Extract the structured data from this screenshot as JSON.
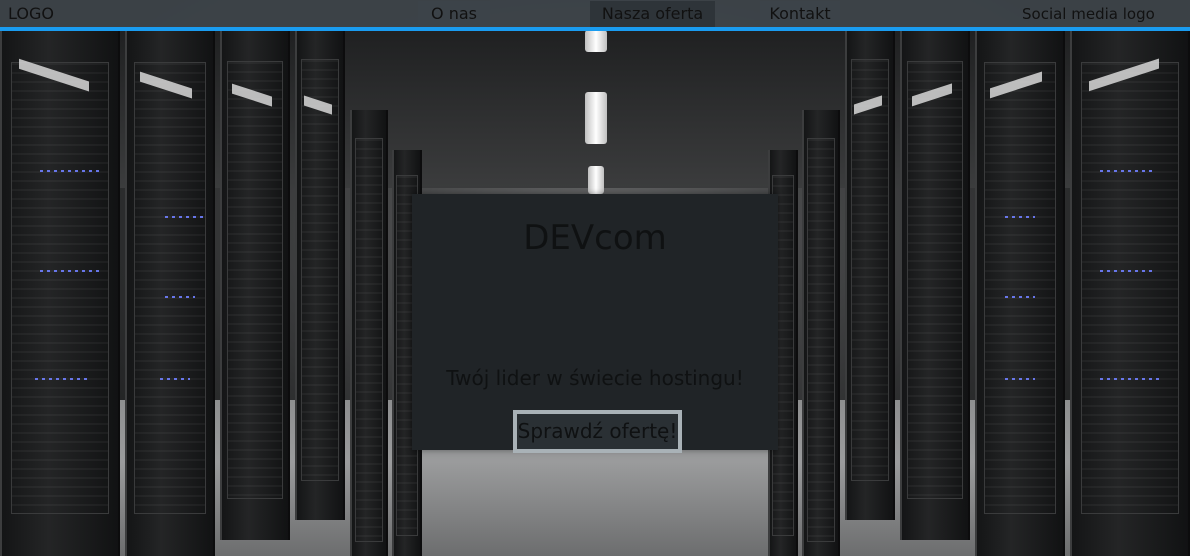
{
  "header": {
    "logo": "LOGO",
    "nav": [
      {
        "label": "O nas"
      },
      {
        "label": "Nasza oferta"
      },
      {
        "label": "Kontakt"
      }
    ],
    "social": "Social media logo"
  },
  "hero": {
    "title": "DEVcom",
    "tagline": "Twój lider w świecie hostingu!",
    "button_label": "Sprawdź ofertę!"
  },
  "colors": {
    "accent_line": "#1a9cf0",
    "header_bg": "#3e444a",
    "card_bg": "#202427",
    "button_border": "#a9b2b7"
  }
}
